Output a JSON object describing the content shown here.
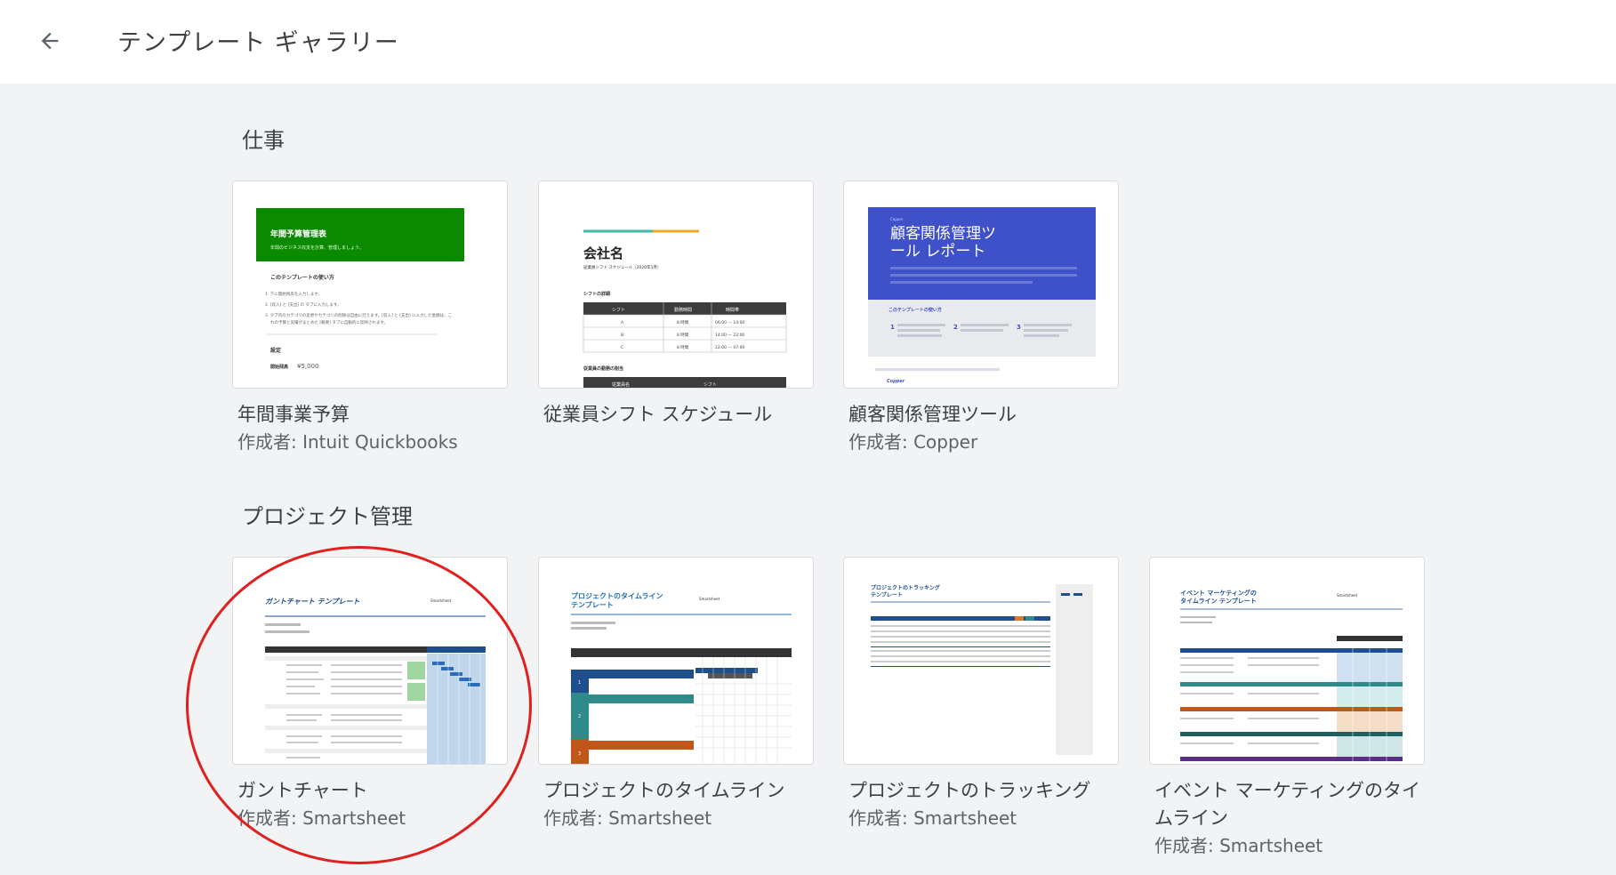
{
  "header": {
    "title": "テンプレート ギャラリー",
    "back_icon": "arrow-back-icon"
  },
  "sections": [
    {
      "title": "仕事",
      "cards": [
        {
          "name": "年間事業予算",
          "author": "作成者: Intuit Quickbooks",
          "thumb": {
            "header_text": "年間予算管理表",
            "header_sub": "年間のビジネス収支を計算、管理しましょう。",
            "howto": "このテンプレートの使い方",
            "steps": [
              "1. 下に開始残高を入力します。",
              "2. [収入] と [支出] の タブに入力します。",
              "3. タブ内のカテゴリの変更やカテゴリの削除は自由に行えます。[収入] と [支出] に入力した金額は、こ",
              "れの予算と実績がまとめた [概要] タブに自動的に反映されます。"
            ],
            "settings": "設定",
            "opening_label": "開始残高",
            "opening_value": "¥5,000",
            "accent": "#0b8a00"
          }
        },
        {
          "name": "従業員シフト スケジュール",
          "author": "",
          "thumb": {
            "company": "会社名",
            "subtitle": "従業員シフト スケジュール（2020年1月）",
            "shift_section": "シフトの詳細",
            "table_headers": [
              "シフト",
              "勤務時間",
              "時間帯"
            ],
            "rows": [
              [
                "A",
                "8 時間",
                "06:00 — 14:00"
              ],
              [
                "B",
                "8 時間",
                "14:00 — 22:00"
              ],
              [
                "C",
                "8 時間",
                "22:00 — 07:00"
              ]
            ],
            "section2": "従業員の勤務の割当",
            "table2_headers": [
              "従業員名",
              "シフト"
            ]
          }
        },
        {
          "name": "顧客関係管理ツール",
          "author": "作成者: Copper",
          "thumb": {
            "tag": "Copper",
            "title_line1": "顧客関係管理ツ",
            "title_line2": "ール レポート",
            "howto": "このテンプレートの使い方",
            "footer_link": "Copper",
            "accent": "#3f51c8"
          }
        }
      ]
    },
    {
      "title": "プロジェクト管理",
      "cards": [
        {
          "name": "ガントチャート",
          "author": "作成者: Smartsheet",
          "thumb": {
            "title": "ガントチャート テンプレート",
            "brand": "Smartsheet"
          }
        },
        {
          "name": "プロジェクトのタイムライン",
          "author": "作成者: Smartsheet",
          "thumb": {
            "title_line1": "プロジェクトのタイムライン",
            "title_line2": "テンプレート",
            "brand": "Smartsheet",
            "phases": [
              "1",
              "2",
              "3"
            ]
          }
        },
        {
          "name": "プロジェクトのトラッキング",
          "author": "作成者: Smartsheet",
          "thumb": {
            "title_line1": "プロジェクトのトラッキング",
            "title_line2": "テンプレート"
          }
        },
        {
          "name": "イベント マーケティングのタイムライン",
          "author": "作成者: Smartsheet",
          "thumb": {
            "title_line1": "イベント マーケティングの",
            "title_line2": "タイムライン テンプレート",
            "brand": "Smartsheet"
          }
        }
      ]
    }
  ],
  "annotation": {
    "color": "#e0201f",
    "shape": "circle around ガントチャート"
  }
}
